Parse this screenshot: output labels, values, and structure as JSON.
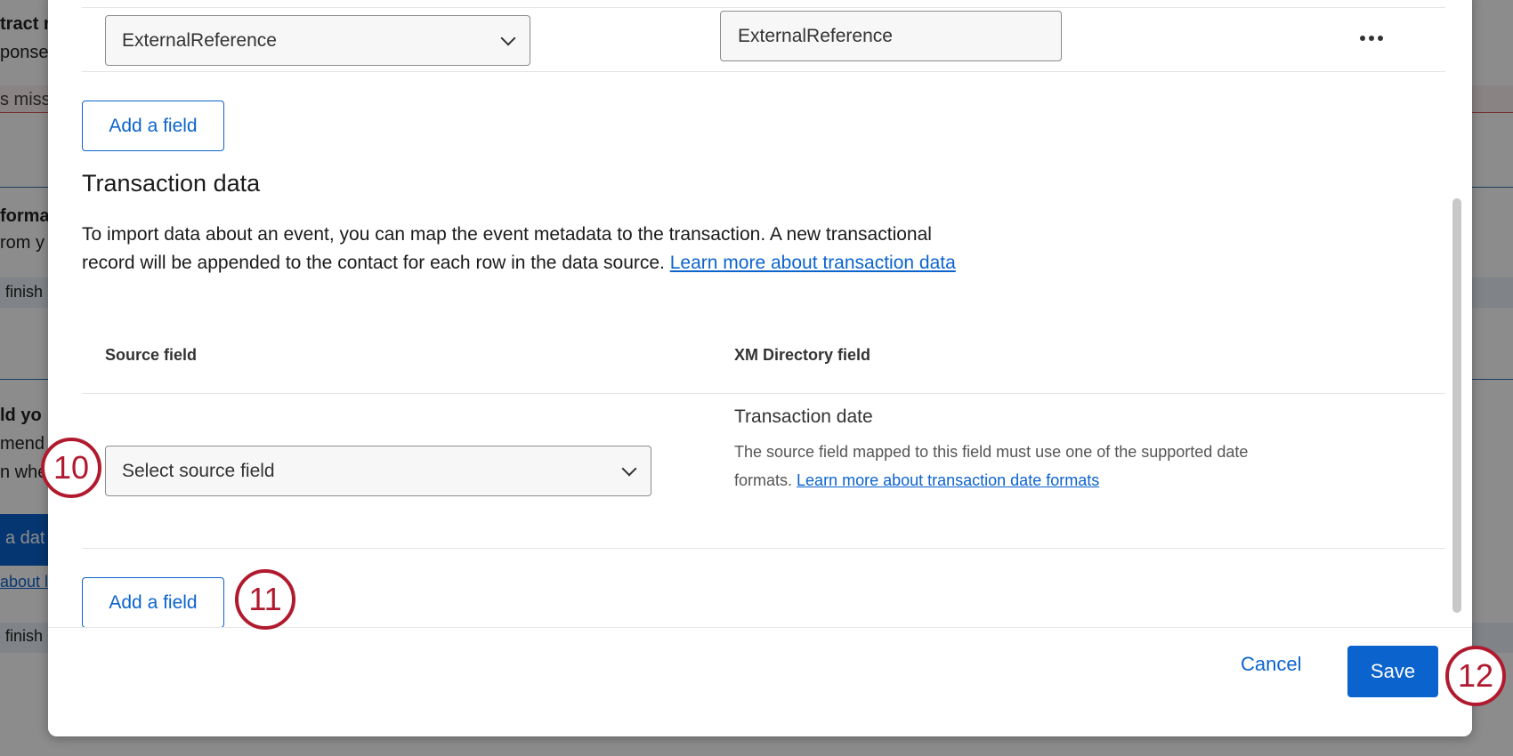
{
  "background_page": {
    "fragments": [
      "tract n",
      "ponse",
      "s missi",
      "forma",
      "rom y",
      "finish",
      "ld yo",
      "mend",
      "n whe",
      "a dat",
      "about l",
      "finish"
    ]
  },
  "modal": {
    "previous_mapping": {
      "source_select_value": "ExternalReference",
      "target_field_value": "ExternalReference",
      "more_options_icon": "more-horizontal-icon"
    },
    "add_field_top_label": "Add a field",
    "transaction": {
      "title": "Transaction data",
      "description": "To import data about an event, you can map the event metadata to the transaction. A new transactional record will be appended to the contact for each row in the data source.",
      "learn_more_link": "Learn more about transaction data",
      "columns": {
        "source": "Source field",
        "target": "XM Directory field"
      },
      "row": {
        "source_placeholder": "Select source field",
        "target_title": "Transaction date",
        "target_help": "The source field mapped to this field must use one of the supported date formats.",
        "target_help_link": "Learn more about transaction date formats"
      },
      "add_field_label": "Add a field"
    },
    "footer": {
      "cancel_label": "Cancel",
      "save_label": "Save"
    }
  },
  "callouts": [
    "10",
    "11",
    "12"
  ],
  "colors": {
    "accent": "#0b63ce",
    "callout": "#b11a2e"
  }
}
